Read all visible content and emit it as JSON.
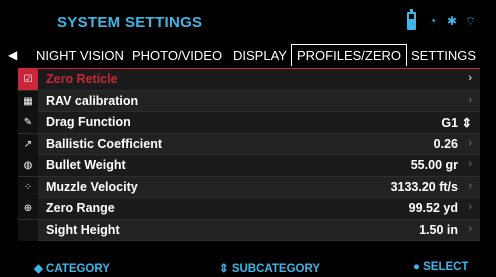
{
  "header": {
    "title": "SYSTEM SETTINGS",
    "status_icons": [
      "battery-icon",
      "timer-icon",
      "bluetooth-icon",
      "wifi-icon"
    ]
  },
  "tabs": [
    {
      "label": "NIGHT VISION"
    },
    {
      "label": "PHOTO/VIDEO"
    },
    {
      "label": "DISPLAY"
    },
    {
      "label": "PROFILES/ZERO",
      "active": true
    },
    {
      "label": "SETTINGS"
    }
  ],
  "rows": [
    {
      "label": "Zero Reticle",
      "value": "",
      "icon": "checkbox-icon",
      "selected": true
    },
    {
      "label": "RAV calibration",
      "value": "",
      "icon": "calculator-icon"
    },
    {
      "label": "Drag Function",
      "value": "G1 ⇕",
      "icon": "edit-icon"
    },
    {
      "label": "Ballistic Coefficient",
      "value": "0.26",
      "icon": "export-icon"
    },
    {
      "label": "Bullet Weight",
      "value": "55.00 gr",
      "icon": "bullet-icon"
    },
    {
      "label": "Muzzle Velocity",
      "value": "3133.20 ft/s",
      "icon": "dots-icon"
    },
    {
      "label": "Zero Range",
      "value": "99.52 yd",
      "icon": "target-icon"
    },
    {
      "label": "Sight Height",
      "value": "1.50 in",
      "icon": ""
    }
  ],
  "footer": {
    "category": "◆ CATEGORY",
    "subcategory": "⇕ SUBCATEGORY",
    "select": "● SELECT"
  },
  "colors": {
    "accent": "#3fb6e8",
    "selection": "#c8273a"
  }
}
